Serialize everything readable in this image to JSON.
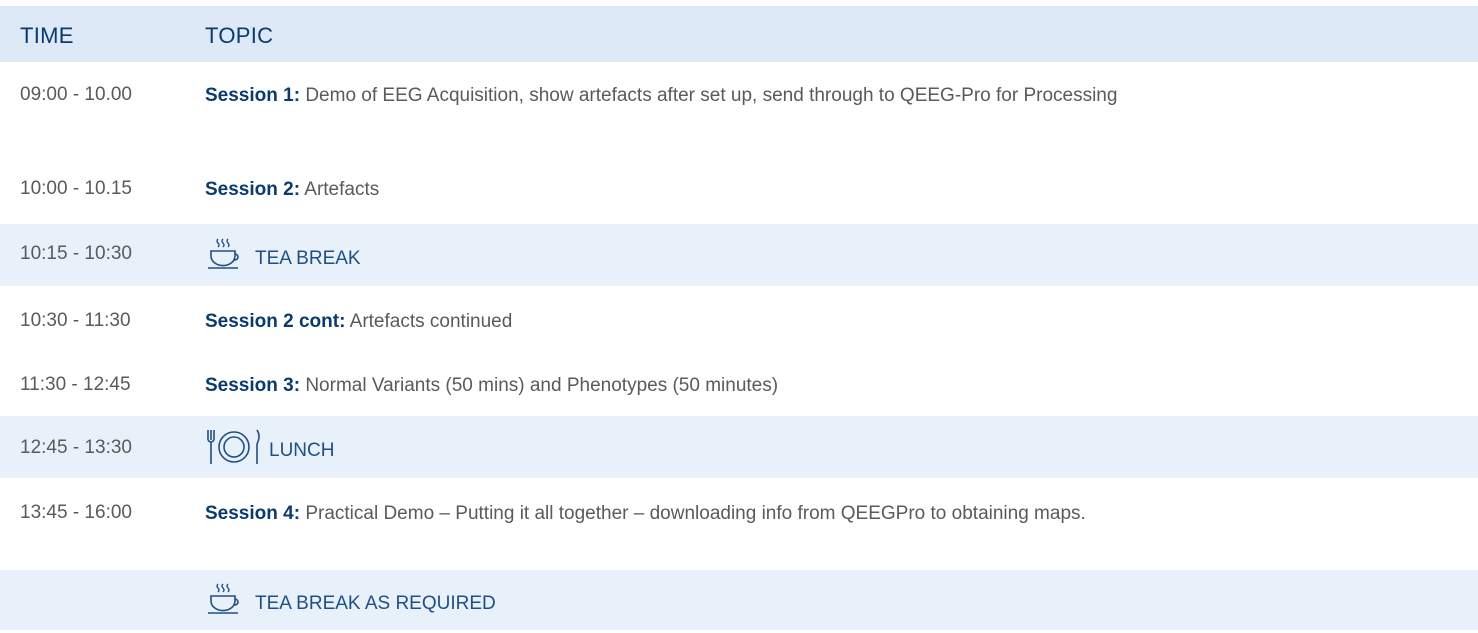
{
  "header": {
    "time": "TIME",
    "topic": "TOPIC"
  },
  "rows": [
    {
      "time": "09:00 - 10.00",
      "session": "Session 1:",
      "text": " Demo of EEG Acquisition, show artefacts after set up, send through to QEEG-Pro for Processing"
    },
    {
      "time": "10:00 - 10.15",
      "session": "Session 2:",
      "text": " Artefacts"
    },
    {
      "time": "10:15 - 10:30",
      "icon": "tea-cup-icon",
      "label": "TEA BREAK"
    },
    {
      "time": "10:30 - 11:30",
      "session": "Session 2 cont:",
      "text": " Artefacts continued"
    },
    {
      "time": "11:30 - 12:45",
      "session": "Session 3:",
      "text": " Normal Variants (50 mins) and Phenotypes (50 minutes)"
    },
    {
      "time": "12:45 - 13:30",
      "icon": "plate-cutlery-icon",
      "label": "LUNCH"
    },
    {
      "time": "13:45 - 16:00",
      "session": "Session 4:",
      "text": " Practical Demo – Putting it all together – downloading info from QEEGPro to obtaining maps."
    },
    {
      "time": "",
      "icon": "tea-cup-icon",
      "label": "TEA BREAK AS REQUIRED"
    }
  ],
  "colors": {
    "header_bg": "#dde9f6",
    "shaded_bg": "#e8f0f9",
    "accent": "#0b3a6e",
    "text": "#5a5a5a"
  }
}
